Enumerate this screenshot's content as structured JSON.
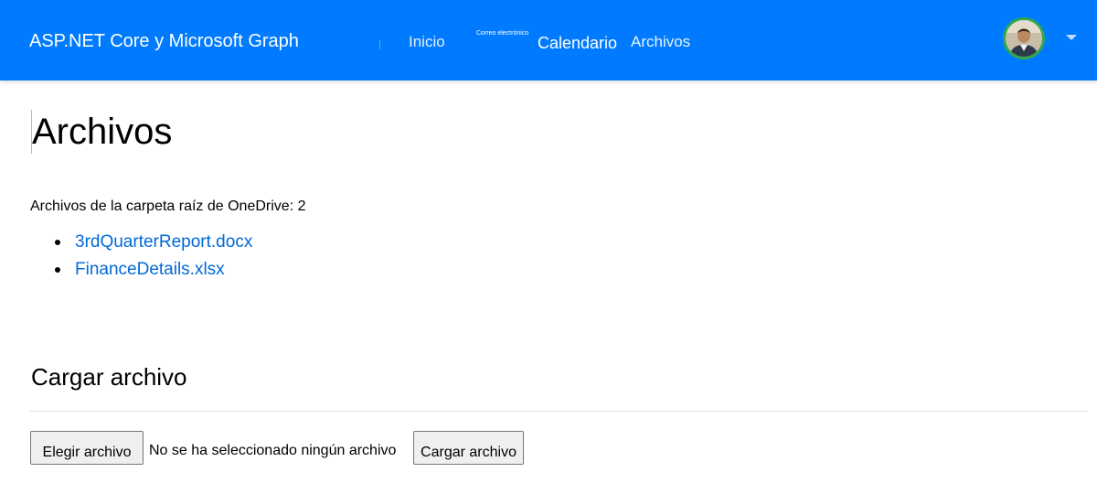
{
  "navbar": {
    "brand": "ASP.NET Core y Microsoft Graph",
    "links": [
      {
        "label": "Inicio"
      },
      {
        "label": "Correo electrónico"
      },
      {
        "label": "Calendario"
      },
      {
        "label": "Archivos"
      }
    ],
    "user_menu_icon": "chevron-down-icon",
    "accent_color": "#007bff"
  },
  "main": {
    "title": "Archivos",
    "files_summary": "Archivos de la carpeta raíz de OneDrive: 2",
    "files": [
      {
        "name": "3rdQuarterReport.docx"
      },
      {
        "name": "FinanceDetails.xlsx"
      }
    ],
    "upload": {
      "title": "Cargar archivo",
      "choose_label": "Elegir archivo",
      "no_file_text": "No se ha seleccionado ningún archivo",
      "submit_label": "Cargar archivo"
    }
  }
}
